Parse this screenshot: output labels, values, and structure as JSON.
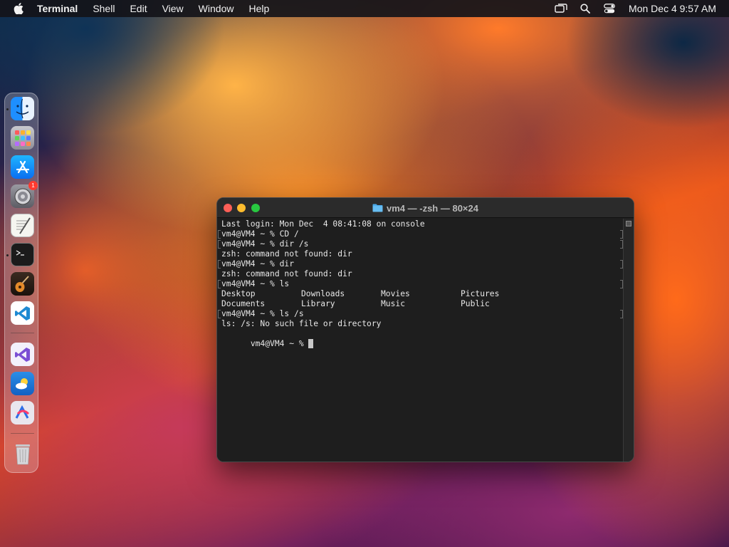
{
  "menubar": {
    "app_name": "Terminal",
    "items": [
      "Shell",
      "Edit",
      "View",
      "Window",
      "Help"
    ],
    "clock": "Mon Dec 4  9:57 AM"
  },
  "dock": {
    "apps": [
      {
        "name": "Finder",
        "icon": "finder-icon",
        "running": true
      },
      {
        "name": "Launchpad",
        "icon": "launchpad-icon",
        "running": false
      },
      {
        "name": "App Store",
        "icon": "app-store-icon",
        "running": false
      },
      {
        "name": "System Settings",
        "icon": "system-settings-icon",
        "running": false,
        "badge": "1"
      },
      {
        "name": "TextEdit",
        "icon": "textedit-icon",
        "running": false
      },
      {
        "name": "Terminal",
        "icon": "terminal-icon",
        "running": true
      },
      {
        "name": "GarageBand",
        "icon": "garageband-icon",
        "running": false
      },
      {
        "name": "Visual Studio Code",
        "icon": "vscode-icon",
        "running": false
      },
      {
        "name": "Visual Studio",
        "icon": "visual-studio-icon",
        "running": false
      },
      {
        "name": "Weather",
        "icon": "weather-icon",
        "running": false
      },
      {
        "name": "Creativit",
        "icon": "creative-app-icon",
        "running": false
      },
      {
        "name": "Trash",
        "icon": "trash-icon",
        "running": false
      }
    ]
  },
  "terminal": {
    "title": "vm4 — -zsh — 80×24",
    "lines": [
      "Last login: Mon Dec  4 08:41:08 on console",
      "vm4@VM4 ~ % CD /",
      "vm4@VM4 ~ % dir /s",
      "zsh: command not found: dir",
      "vm4@VM4 ~ % dir",
      "zsh: command not found: dir",
      "vm4@VM4 ~ % ls",
      "",
      "",
      "vm4@VM4 ~ % ls /s",
      "ls: /s: No such file or directory",
      "vm4@VM4 ~ % "
    ],
    "ls_output": {
      "row1": [
        "Desktop",
        "Downloads",
        "Movies",
        "Pictures"
      ],
      "row2": [
        "Documents",
        "Library",
        "Music",
        "Public"
      ]
    }
  }
}
